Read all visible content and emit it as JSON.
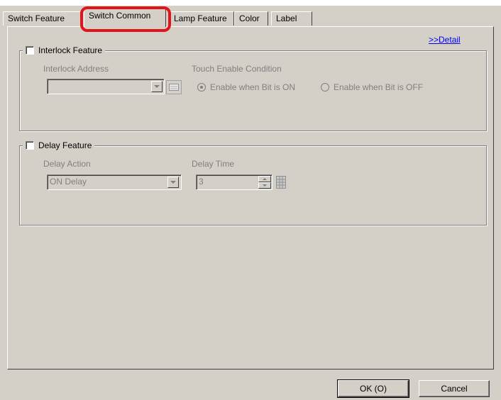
{
  "tabs": [
    {
      "label": "Switch Feature"
    },
    {
      "label": "Switch Common"
    },
    {
      "label": "Lamp Feature"
    },
    {
      "label": "Color"
    },
    {
      "label": "Label"
    }
  ],
  "detail_link": ">>Detail",
  "interlock": {
    "title": "Interlock Feature",
    "address_label": "Interlock Address",
    "address_value": "",
    "condition_label": "Touch Enable Condition",
    "option_on": "Enable when Bit is ON",
    "option_off": "Enable when Bit is OFF",
    "selected": "on"
  },
  "delay": {
    "title": "Delay Feature",
    "action_label": "Delay Action",
    "action_value": "ON Delay",
    "time_label": "Delay Time",
    "time_value": "3"
  },
  "buttons": {
    "ok": "OK (O)",
    "cancel": "Cancel"
  },
  "colors": {
    "highlight": "#e0141a",
    "link": "#0000ff",
    "dialog_bg": "#d4d0c8"
  }
}
